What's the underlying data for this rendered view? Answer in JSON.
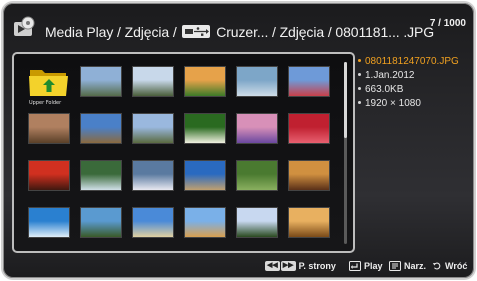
{
  "header": {
    "path_prefix": "Media Play / Zdjęcia / ",
    "path_suffix": " Cruzer... / Zdjęcia / 0801181... .JPG",
    "counter": "7 / 1000",
    "app_icon": "media-play-icon",
    "device_icon": "usb-icon"
  },
  "grid": {
    "folder_label": "Upper Folder",
    "thumbnails": [
      {
        "name": "upper-folder",
        "colors": [
          "#f3d22b",
          "#c99a00"
        ]
      },
      {
        "name": "mountain-lake",
        "colors": [
          "#8fb0d6",
          "#556b4a"
        ]
      },
      {
        "name": "snowy-field",
        "colors": [
          "#c8d8ea",
          "#4a5e3a"
        ]
      },
      {
        "name": "green-field-sunset",
        "colors": [
          "#e6a24a",
          "#3c7a28"
        ]
      },
      {
        "name": "icy-lake",
        "colors": [
          "#7da6c8",
          "#cfdde8"
        ]
      },
      {
        "name": "pink-flowers",
        "colors": [
          "#6e9ad8",
          "#c8404a"
        ]
      },
      {
        "name": "desert-rock",
        "colors": [
          "#b08060",
          "#5a4028"
        ]
      },
      {
        "name": "coastal-rocks",
        "colors": [
          "#4a80c8",
          "#8a6a40"
        ]
      },
      {
        "name": "mountain-range",
        "colors": [
          "#9ab8de",
          "#5a6a40"
        ]
      },
      {
        "name": "white-flower",
        "colors": [
          "#2a6a20",
          "#f0f0e0"
        ]
      },
      {
        "name": "lavender-field",
        "colors": [
          "#d890b8",
          "#6a48a0"
        ]
      },
      {
        "name": "red-petals",
        "colors": [
          "#c02030",
          "#e86070"
        ]
      },
      {
        "name": "red-coral",
        "colors": [
          "#d03020",
          "#401810"
        ]
      },
      {
        "name": "waterfall",
        "colors": [
          "#3a6a3a",
          "#d0e0e8"
        ]
      },
      {
        "name": "waterfall-rocks",
        "colors": [
          "#5a7aa0",
          "#e8e8f0"
        ]
      },
      {
        "name": "sea-cliffs",
        "colors": [
          "#2a6ac0",
          "#c0a070"
        ]
      },
      {
        "name": "forest-pond",
        "colors": [
          "#4a7a30",
          "#8ab060"
        ]
      },
      {
        "name": "autumn-bench",
        "colors": [
          "#d09040",
          "#5a3018"
        ]
      },
      {
        "name": "ocean-wave",
        "colors": [
          "#2a80d0",
          "#e0eef8"
        ]
      },
      {
        "name": "palm-trees",
        "colors": [
          "#5a9ad0",
          "#3a5a28"
        ]
      },
      {
        "name": "island-bay",
        "colors": [
          "#4a8ad8",
          "#e0d0a0"
        ]
      },
      {
        "name": "pyramid",
        "colors": [
          "#7ab0e8",
          "#d8a050"
        ]
      },
      {
        "name": "lone-tree",
        "colors": [
          "#c8d8f0",
          "#2a4a20"
        ]
      },
      {
        "name": "bare-tree-sunset",
        "colors": [
          "#e8b060",
          "#7a4a18"
        ]
      }
    ]
  },
  "info": {
    "filename": "0801181247070.JPG",
    "date": "1.Jan.2012",
    "size": "663.0KB",
    "resolution": "1920 × 1080"
  },
  "footer": {
    "page_label": "P. strony",
    "play_label": "Play",
    "tools_label": "Narz.",
    "back_label": "Wróć"
  },
  "colors": {
    "accent_orange": "#f0a020",
    "selection_yellow": "#e8c800"
  }
}
